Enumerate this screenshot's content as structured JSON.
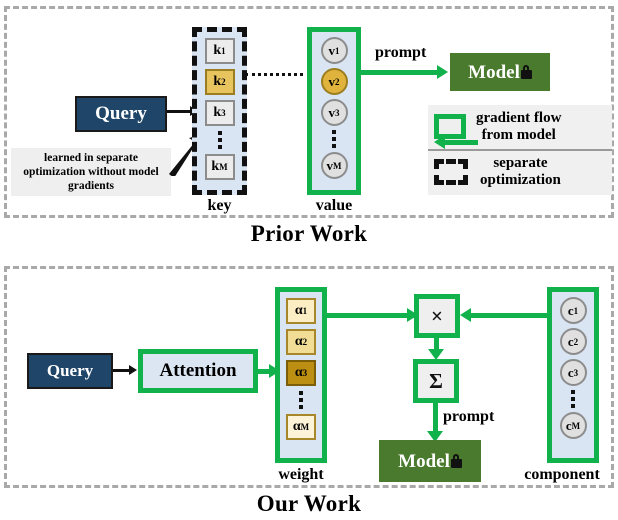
{
  "figure": {
    "panels": [
      {
        "id": "prior",
        "title": "Prior Work"
      },
      {
        "id": "ours",
        "title": "Our Work"
      }
    ]
  },
  "colors": {
    "green": "#11b14c",
    "navy": "#1f4568",
    "model_green": "#4a7a2e",
    "gold": "#e8c45f",
    "column_fill": "#d9e5f2",
    "panel_border": "#a9a9a9"
  },
  "prior": {
    "query_label": "Query",
    "annotation": "learned in separate optimization without model gradients",
    "key_column": {
      "label": "key",
      "items": [
        {
          "text": "k",
          "sub": "1",
          "highlighted": false
        },
        {
          "text": "k",
          "sub": "2",
          "highlighted": true
        },
        {
          "text": "k",
          "sub": "3",
          "highlighted": false
        },
        {
          "text": "⋮",
          "sub": "",
          "highlighted": false
        },
        {
          "text": "k",
          "sub": "M",
          "highlighted": false
        }
      ]
    },
    "value_column": {
      "label": "value",
      "items": [
        {
          "text": "v",
          "sub": "1",
          "highlighted": false
        },
        {
          "text": "v",
          "sub": "2",
          "highlighted": true
        },
        {
          "text": "v",
          "sub": "3",
          "highlighted": false
        },
        {
          "text": "⋮",
          "sub": "",
          "highlighted": false
        },
        {
          "text": "v",
          "sub": "M",
          "highlighted": false
        }
      ]
    },
    "prompt_label": "prompt",
    "model_label": "Model",
    "legend": {
      "gradient_flow": "gradient flow\nfrom model",
      "gradient_flow_line1": "gradient flow",
      "gradient_flow_line2": "from model",
      "separate_opt_line1": "separate",
      "separate_opt_line2": "optimization"
    }
  },
  "ours": {
    "query_label": "Query",
    "attention_label": "Attention",
    "weight_column": {
      "label": "weight",
      "items": [
        {
          "text": "α",
          "sub": "1",
          "shade": "g1"
        },
        {
          "text": "α",
          "sub": "2",
          "shade": "g2"
        },
        {
          "text": "α",
          "sub": "3",
          "shade": "g3"
        },
        {
          "text": "⋮",
          "sub": "",
          "shade": ""
        },
        {
          "text": "α",
          "sub": "M",
          "shade": "g4"
        }
      ]
    },
    "component_column": {
      "label": "component",
      "items": [
        {
          "text": "c",
          "sub": "1"
        },
        {
          "text": "c",
          "sub": "2"
        },
        {
          "text": "c",
          "sub": "3"
        },
        {
          "text": "⋮",
          "sub": ""
        },
        {
          "text": "c",
          "sub": "M"
        }
      ]
    },
    "multiply_symbol": "×",
    "sum_symbol": "Σ",
    "prompt_label": "prompt",
    "model_label": "Model"
  }
}
